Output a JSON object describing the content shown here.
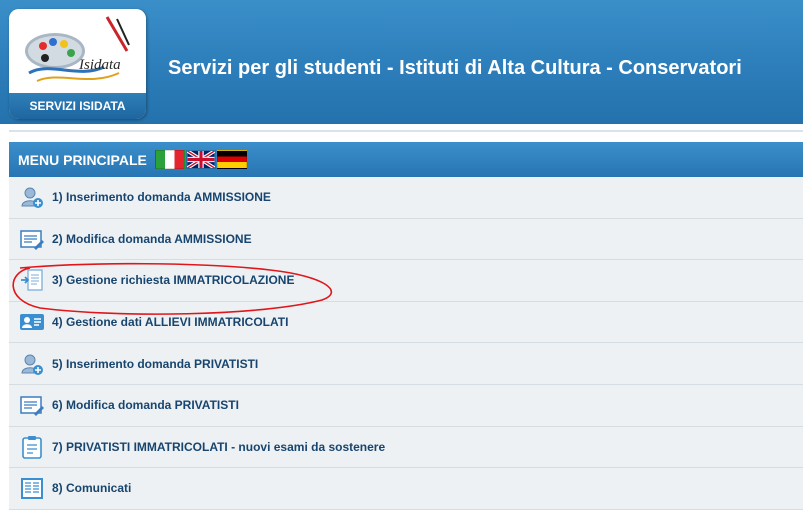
{
  "header": {
    "logo_caption": "SERVIZI ISIDATA",
    "logo_text": "Isidata",
    "title": "Servizi per gli studenti - Istituti di Alta Cultura - Conservatori"
  },
  "menu": {
    "title": "MENU PRINCIPALE",
    "flags": [
      "flag-italy-icon",
      "flag-uk-icon",
      "flag-germany-icon"
    ],
    "items": [
      {
        "label": "1) Inserimento domanda AMMISSIONE",
        "icon": "user-add-icon"
      },
      {
        "label": "2) Modifica domanda AMMISSIONE",
        "icon": "edit-document-icon"
      },
      {
        "label": "3) Gestione richiesta IMMATRICOLAZIONE",
        "icon": "enrollment-document-icon"
      },
      {
        "label": "4) Gestione dati ALLIEVI IMMATRICOLATI",
        "icon": "id-card-icon"
      },
      {
        "label": "5) Inserimento domanda PRIVATISTI",
        "icon": "user-add-icon"
      },
      {
        "label": "6) Modifica domanda PRIVATISTI",
        "icon": "edit-document-icon"
      },
      {
        "label": "7) PRIVATISTI IMMATRICOLATI - nuovi esami da sostenere",
        "icon": "clipboard-icon"
      },
      {
        "label": "8) Comunicati",
        "icon": "newspaper-icon"
      }
    ]
  },
  "colors": {
    "header_blue": "#2b7cb8",
    "menu_item_bg": "#eef1f3",
    "menu_text": "#17456f",
    "annotation_red": "#e0161b"
  }
}
